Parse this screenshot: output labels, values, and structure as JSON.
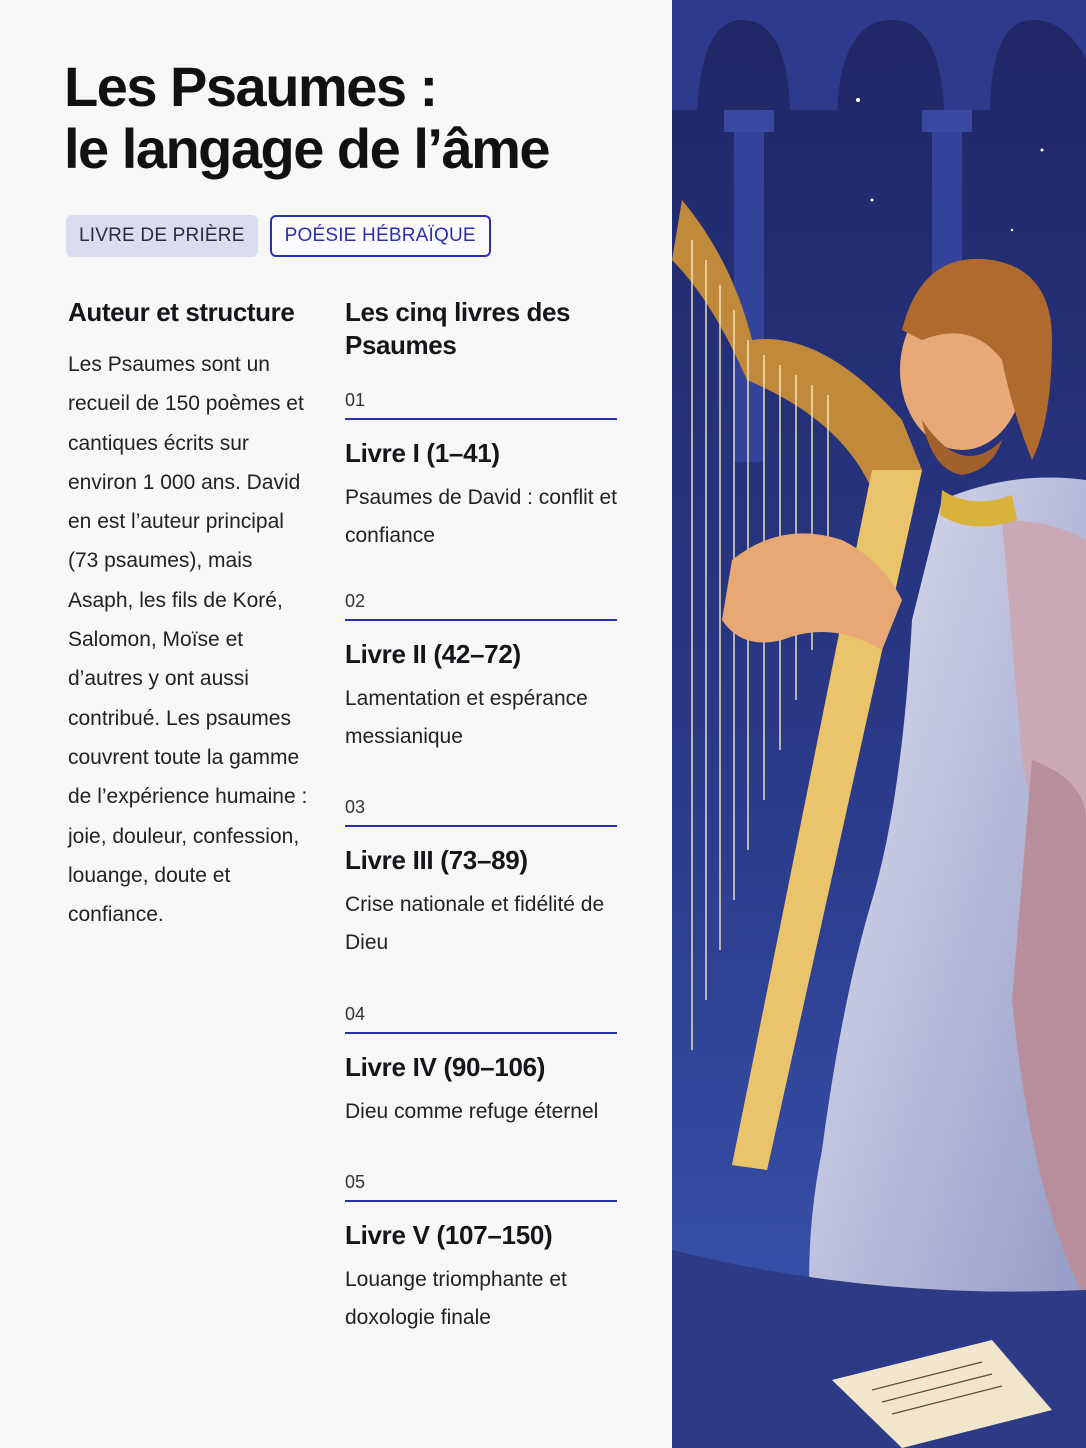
{
  "title": {
    "line1": "Les Psaumes :",
    "line2": "le langage de l’âme"
  },
  "tags": [
    {
      "label": "LIVRE DE PRIÈRE"
    },
    {
      "label": "POÉSIE HÉBRAÏQUE"
    }
  ],
  "author_section": {
    "heading": "Auteur et structure",
    "body": "Les Psaumes sont un recueil de 150 poèmes et cantiques écrits sur environ 1 000 ans. David en est l’auteur principal (73 psaumes), mais Asaph, les fils de Koré, Salomon, Moïse et d’autres y ont aussi contribué. Les psaumes couvrent toute la gamme de l’expérience humaine : joie, douleur, confession, louange, doute et confiance."
  },
  "books_section": {
    "heading": "Les cinq livres des Psaumes",
    "books": [
      {
        "num": "01",
        "title": "Livre I (1–41)",
        "desc": "Psaumes de David : conflit et confiance"
      },
      {
        "num": "02",
        "title": "Livre II (42–72)",
        "desc": "Lamentation et espérance messianique"
      },
      {
        "num": "03",
        "title": "Livre III (73–89)",
        "desc": "Crise nationale et fidélité de Dieu"
      },
      {
        "num": "04",
        "title": "Livre IV (90–106)",
        "desc": "Dieu comme refuge éternel"
      },
      {
        "num": "05",
        "title": "Livre V (107–150)",
        "desc": "Louange triomphante et doxologie finale"
      }
    ]
  },
  "colors": {
    "accent": "#2b2fb0",
    "tag_fill": "#dcdcef",
    "night_sky": "#26307a"
  },
  "illustration": {
    "subject": "harpist-playing-harp-illustration"
  }
}
